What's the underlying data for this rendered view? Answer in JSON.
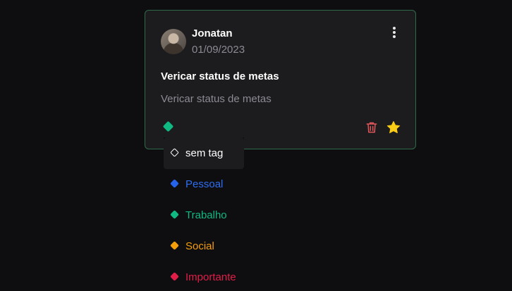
{
  "card": {
    "author": "Jonatan",
    "date": "01/09/2023",
    "title": "Vericar status de metas",
    "description": "Vericar status de metas",
    "selected_tag_color": "#10b981"
  },
  "tag_menu": {
    "options": [
      {
        "label": "sem tag",
        "color": "#ffffff"
      },
      {
        "label": "Pessoal",
        "color": "#2563eb"
      },
      {
        "label": "Trabalho",
        "color": "#10b981"
      },
      {
        "label": "Social",
        "color": "#f59e0b"
      },
      {
        "label": "Importante",
        "color": "#e11d48"
      }
    ]
  },
  "icons": [
    "user-avatar",
    "more-vertical-icon",
    "tag-diamond-icon",
    "trash-icon",
    "star-icon"
  ],
  "colors": {
    "background": "#0e0e10",
    "card": "#1c1c1e",
    "card_border": "#2f6b4a",
    "trash": "#e0575b",
    "star": "#facc15"
  }
}
